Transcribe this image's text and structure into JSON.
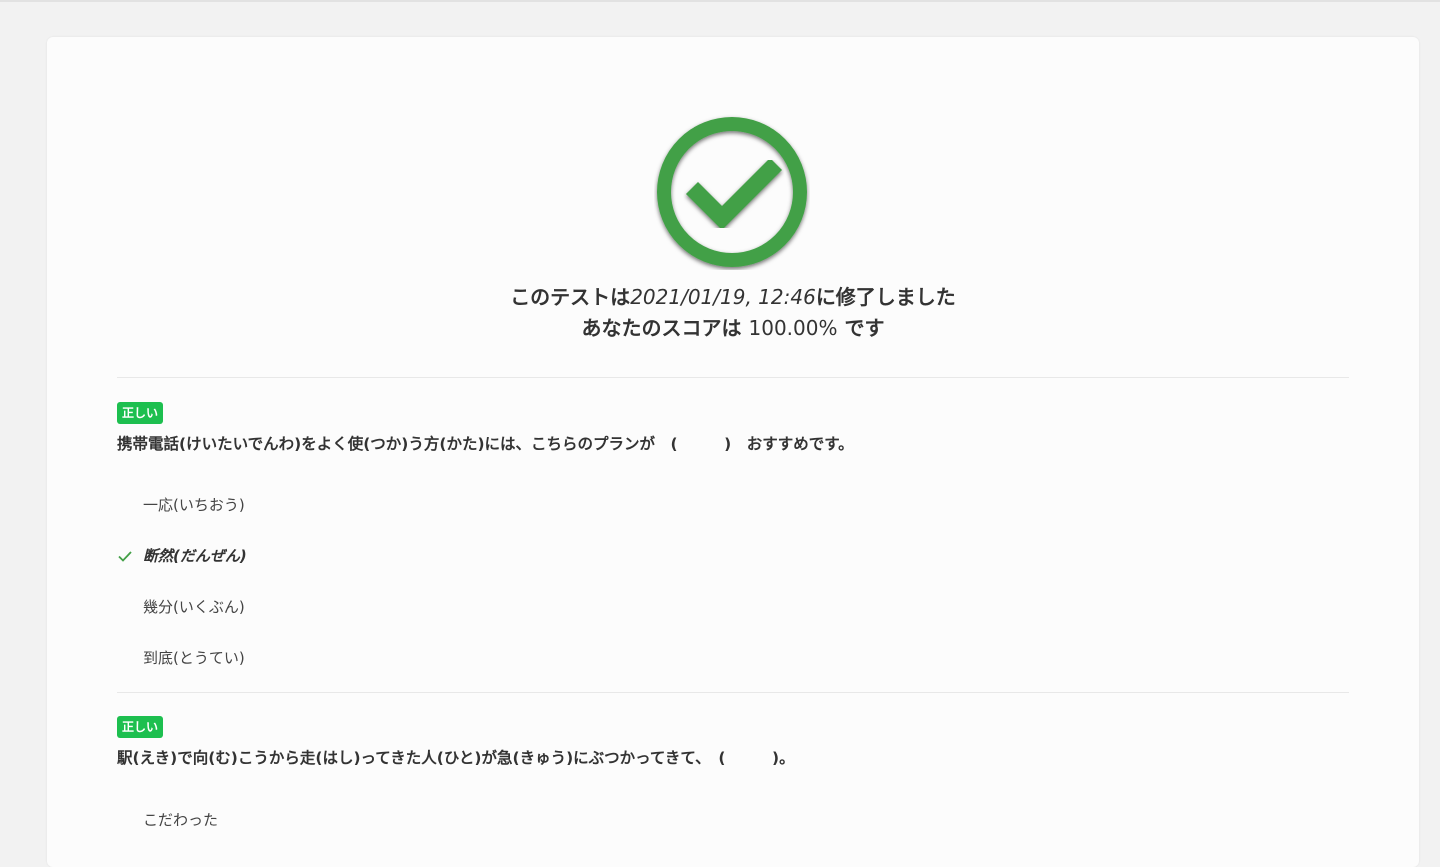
{
  "result": {
    "prefix": "このテストは",
    "datetime": "2021/01/19, 12:46",
    "suffix": "に修了しました",
    "score_prefix": "あなたのスコアは",
    "score_value": "100.00%",
    "score_suffix": "です",
    "icon": "check-circle-icon",
    "accent_color": "#43a047"
  },
  "questions": [
    {
      "badge": "正しい",
      "text": "携帯電話(けいたいでんわ)をよく使(つか)う方(かた)には、こちらのプランが　(　　　)　おすすめです。",
      "options": [
        {
          "label": "一応(いちおう)",
          "selected": false
        },
        {
          "label": "断然(だんぜん)",
          "selected": true
        },
        {
          "label": "幾分(いくぶん)",
          "selected": false
        },
        {
          "label": "到底(とうてい)",
          "selected": false
        }
      ]
    },
    {
      "badge": "正しい",
      "text": "駅(えき)で向(む)こうから走(はし)ってきた人(ひと)が急(きゅう)にぶつかってきて、　(　　　)。",
      "options": [
        {
          "label": "こだわった",
          "selected": false
        }
      ]
    }
  ],
  "colors": {
    "badge": "#1dbf4f",
    "check": "#43a047",
    "background": "#f2f2f2",
    "card": "#fcfcfc"
  }
}
